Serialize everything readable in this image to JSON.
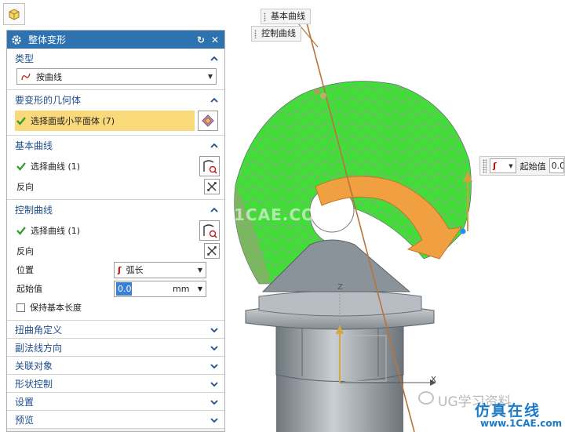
{
  "dialog": {
    "title": "整体变形",
    "groups": {
      "type": {
        "header": "类型",
        "select_value": "按曲线"
      },
      "geometry": {
        "header": "要变形的几何体",
        "select_label": "选择面或小平面体 (7)"
      },
      "basic_curve": {
        "header": "基本曲线",
        "select_label": "选择曲线 (1)",
        "reverse_label": "反向"
      },
      "control_curve": {
        "header": "控制曲线",
        "select_label": "选择曲线 (1)",
        "reverse_label": "反向",
        "position_label": "位置",
        "position_value": "弧长",
        "start_label": "起始值",
        "start_value": "0.0",
        "start_unit": "mm",
        "keep_length_label": "保持基本长度"
      }
    },
    "collapsed_groups": [
      "扭曲角定义",
      "副法线方向",
      "关联对象",
      "形状控制",
      "设置",
      "预览"
    ]
  },
  "viewport": {
    "label_basic_curve": "基本曲线",
    "label_control_curve": "控制曲线",
    "float_start_label": "起始值",
    "float_start_value": "0.0",
    "axis_z": "Z",
    "axis_x": "X",
    "watermark_center": "1CAE.COM",
    "watermark_ug": "UG学习资料",
    "watermark_cn": "仿真在线",
    "watermark_url": "www.1CAE.com"
  },
  "colors": {
    "title_bar": "#2e73b0",
    "group_header": "#1e4e8c",
    "selection_highlight": "#f9d97a",
    "mesh_green": "#3ee034",
    "arrow_orange": "#f0a040",
    "metal_gray": "#8f979e",
    "curve_line": "#b8743a"
  }
}
